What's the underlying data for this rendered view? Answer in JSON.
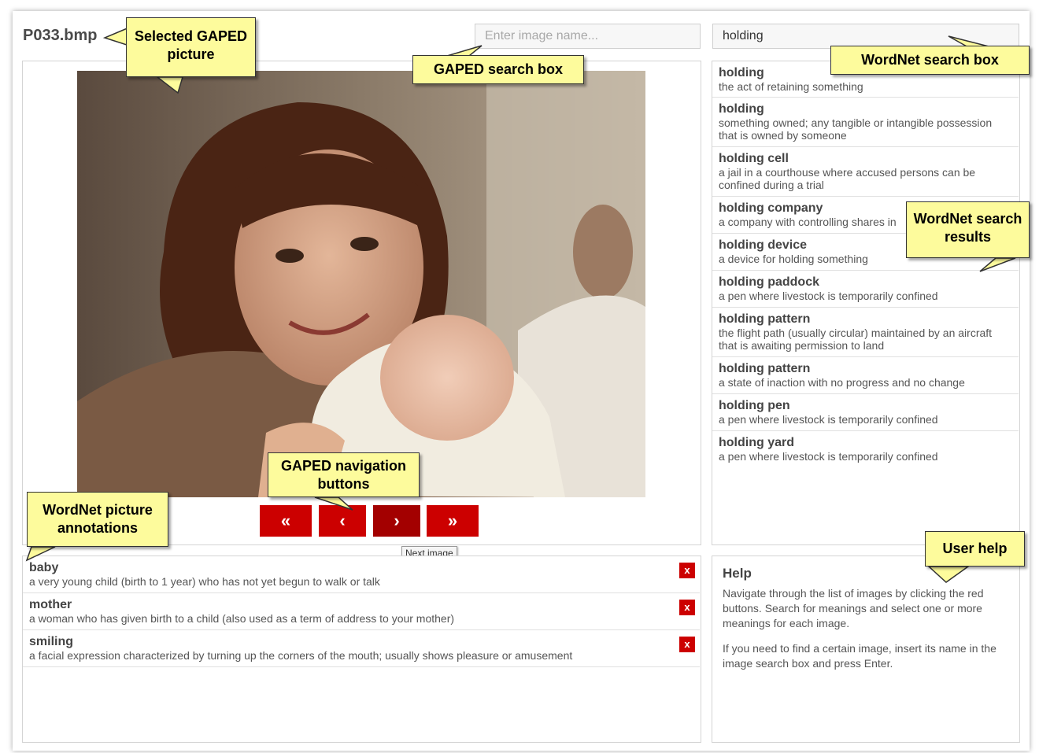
{
  "header": {
    "filename": "P033.bmp",
    "image_search_placeholder": "Enter image name...",
    "wordnet_search_value": "holding"
  },
  "navigation": {
    "first": "«",
    "prev": "‹",
    "next": "›",
    "last": "»",
    "tooltip": "Next image"
  },
  "results": [
    {
      "term": "holding",
      "def": "the act of retaining something"
    },
    {
      "term": "holding",
      "def": "something owned; any tangible or intangible possession that is owned by someone"
    },
    {
      "term": "holding cell",
      "def": "a jail in a courthouse where accused persons can be confined during a trial"
    },
    {
      "term": "holding company",
      "def": "a company with controlling shares in"
    },
    {
      "term": "holding device",
      "def": "a device for holding something"
    },
    {
      "term": "holding paddock",
      "def": "a pen where livestock is temporarily confined"
    },
    {
      "term": "holding pattern",
      "def": "the flight path (usually circular) maintained by an aircraft that is awaiting permission to land"
    },
    {
      "term": "holding pattern",
      "def": "a state of inaction with no progress and no change"
    },
    {
      "term": "holding pen",
      "def": "a pen where livestock is temporarily confined"
    },
    {
      "term": "holding yard",
      "def": "a pen where livestock is temporarily confined"
    }
  ],
  "annotations": [
    {
      "term": "baby",
      "def": "a very young child (birth to 1 year) who has not yet begun to walk or talk",
      "remove": "x"
    },
    {
      "term": "mother",
      "def": "a woman who has given birth to a child (also used as a term of address to your mother)",
      "remove": "x"
    },
    {
      "term": "smiling",
      "def": "a facial expression characterized by turning up the corners of the mouth; usually shows pleasure or amusement",
      "remove": "x"
    }
  ],
  "help": {
    "title": "Help",
    "p1": "Navigate through the list of images by clicking the red buttons. Search for meanings and select one or more meanings for each image.",
    "p2": "If you need to find a certain image, insert its name in the image search box and press Enter."
  },
  "callouts": {
    "selected_picture": "Selected GAPED picture",
    "gaped_search": "GAPED search box",
    "wordnet_search": "WordNet search box",
    "wordnet_results": "WordNet search results",
    "navigation": "GAPED navigation buttons",
    "annotations": "WordNet picture annotations",
    "user_help": "User help"
  },
  "colors": {
    "button_red": "#cc0000",
    "callout_yellow": "#fdfb9c"
  }
}
